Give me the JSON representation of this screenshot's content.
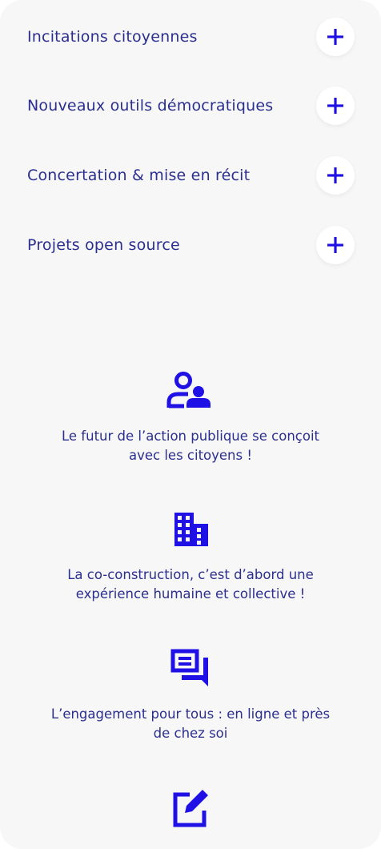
{
  "accordion": {
    "items": [
      {
        "label": "Incitations citoyennes",
        "icon": "plus-icon"
      },
      {
        "label": "Nouveaux outils démocratiques",
        "icon": "plus-icon"
      },
      {
        "label": "Concertation & mise en récit",
        "icon": "plus-icon"
      },
      {
        "label": "Projets open source",
        "icon": "plus-icon"
      }
    ]
  },
  "features": [
    {
      "icon": "people-icon",
      "line1": "Le futur de l’action publique se conçoit",
      "line2": "avec les citoyens !"
    },
    {
      "icon": "building-icon",
      "line1": "La co-construction, c’est d’abord une",
      "line2": "expérience humaine et collective !"
    },
    {
      "icon": "chat-icon",
      "line1": "L’engagement pour tous : en ligne et près",
      "line2": "de chez soi"
    },
    {
      "icon": "edit-icon"
    }
  ],
  "colors": {
    "accent": "#1f10e6",
    "text": "#2b2f8f",
    "background": "#f7f7f7"
  }
}
